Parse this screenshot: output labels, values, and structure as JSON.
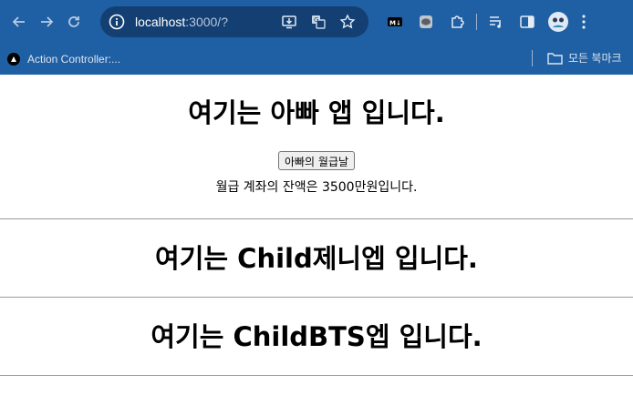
{
  "browser": {
    "url_host": "localhost",
    "url_rest": ":3000/?",
    "bookmark_item": "Action Controller:...",
    "all_bookmarks_label": "모든 북마크"
  },
  "parent_app": {
    "title": "여기는 아빠 앱 입니다.",
    "button_label": "아빠의 월급날",
    "balance_text": "월급 계좌의 잔액은 3500만원입니다."
  },
  "children": [
    {
      "title": "여기는 Child제니엡 입니다."
    },
    {
      "title": "여기는 ChildBTS엡 입니다."
    }
  ],
  "colors": {
    "chrome_bg": "#1f5fa3",
    "omnibox_bg": "#133f73",
    "divider": "#9a9a9a"
  }
}
